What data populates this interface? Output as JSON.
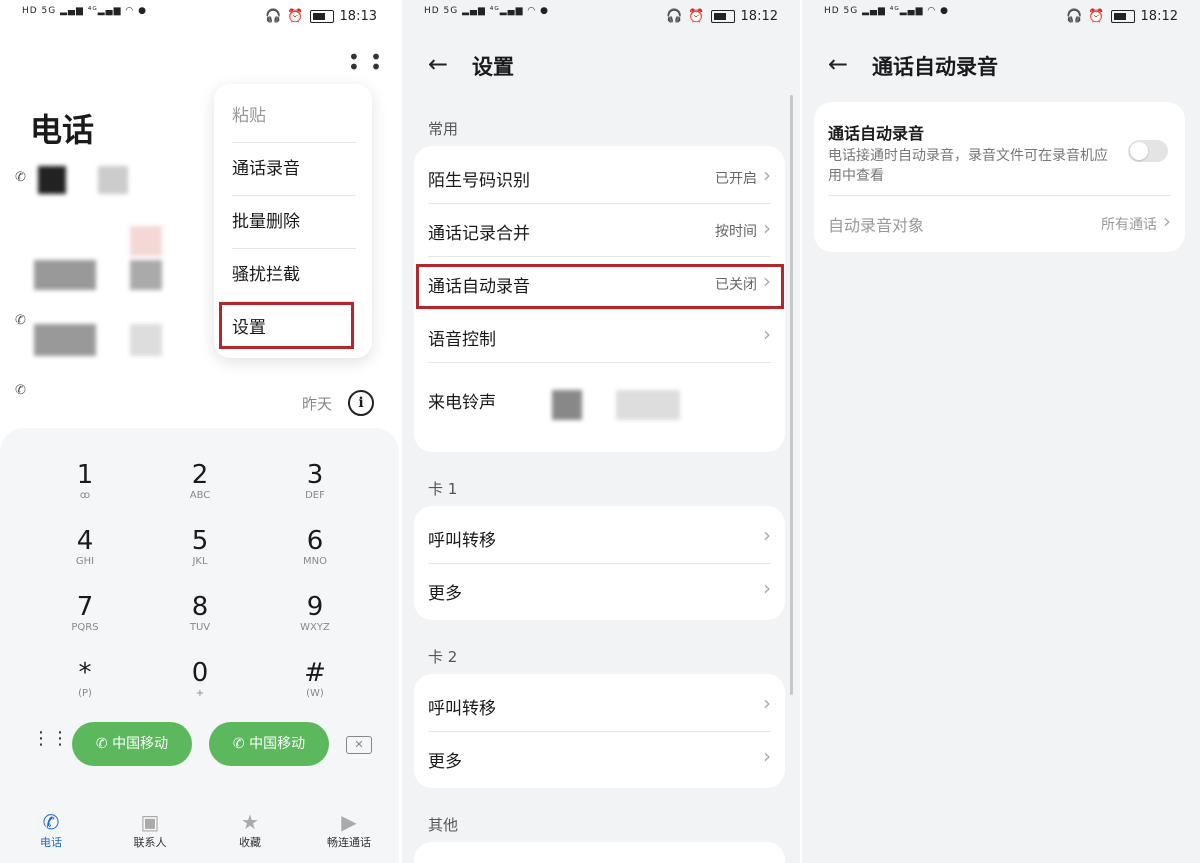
{
  "panel1": {
    "time": "18:13",
    "title": "电话",
    "menu": [
      "粘贴",
      "通话录音",
      "批量删除",
      "骚扰拦截",
      "设置"
    ],
    "yesterday": "昨天",
    "keys": [
      {
        "d": "1",
        "l": "ꝏ"
      },
      {
        "d": "2",
        "l": "ABC"
      },
      {
        "d": "3",
        "l": "DEF"
      },
      {
        "d": "4",
        "l": "GHI"
      },
      {
        "d": "5",
        "l": "JKL"
      },
      {
        "d": "6",
        "l": "MNO"
      },
      {
        "d": "7",
        "l": "PQRS"
      },
      {
        "d": "8",
        "l": "TUV"
      },
      {
        "d": "9",
        "l": "WXYZ"
      },
      {
        "d": "*",
        "l": "(P)"
      },
      {
        "d": "0",
        "l": "+"
      },
      {
        "d": "#",
        "l": "(W)"
      }
    ],
    "call_buttons": [
      "中国移动",
      "中国移动"
    ],
    "nav": [
      "电话",
      "联系人",
      "收藏",
      "畅连通话"
    ]
  },
  "panel2": {
    "time": "18:12",
    "title": "设置",
    "section_common": "常用",
    "common_rows": [
      {
        "label": "陌生号码识别",
        "value": "已开启"
      },
      {
        "label": "通话记录合并",
        "value": "按时间"
      },
      {
        "label": "通话自动录音",
        "value": "已关闭"
      },
      {
        "label": "语音控制",
        "value": ""
      },
      {
        "label": "来电铃声",
        "value": ""
      }
    ],
    "section_card1": "卡 1",
    "card1_rows": [
      "呼叫转移",
      "更多"
    ],
    "section_card2": "卡 2",
    "card2_rows": [
      "呼叫转移",
      "更多"
    ],
    "section_other": "其他"
  },
  "panel3": {
    "time": "18:12",
    "title": "通话自动录音",
    "toggle_title": "通话自动录音",
    "toggle_desc": "电话接通时自动录音，录音文件可在录音机应用中查看",
    "toggle_on": false,
    "target_label": "自动录音对象",
    "target_value": "所有通话"
  },
  "colors": {
    "highlight_box": "#b3262b",
    "call_button": "#5cb85c",
    "nav_active": "#1b67d8"
  }
}
